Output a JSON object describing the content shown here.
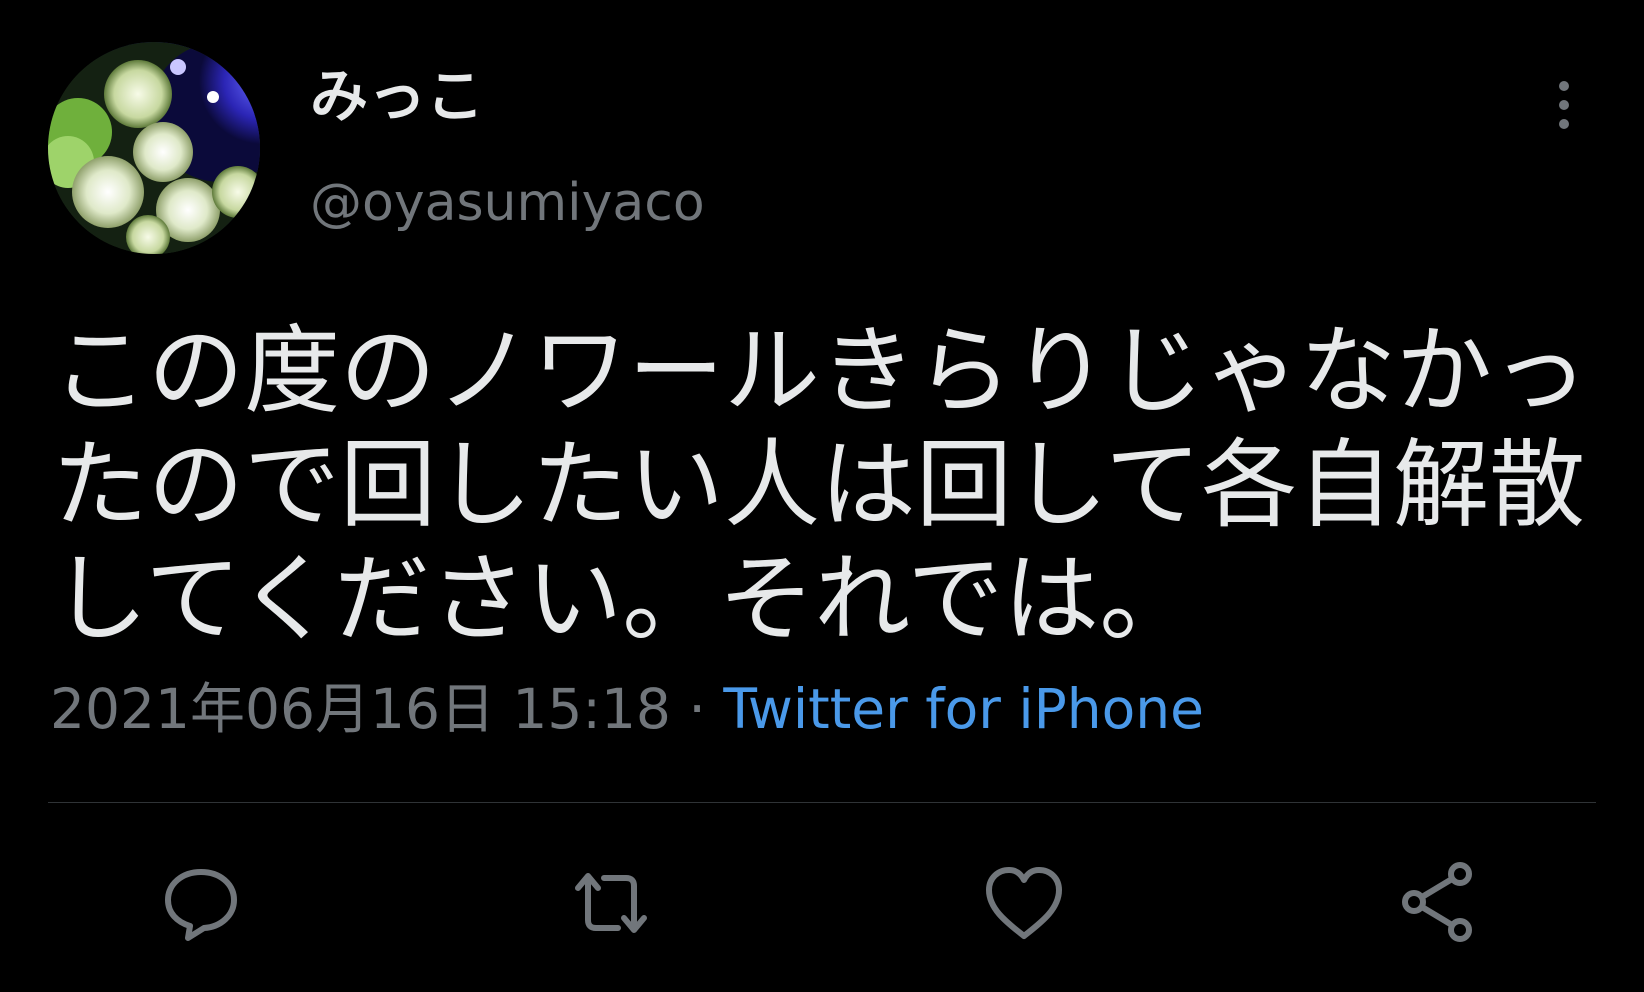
{
  "user": {
    "display_name": "みっこ",
    "handle": "@oyasumiyaco"
  },
  "tweet": {
    "text": "この度のノワールきらりじゃなかったので回したい人は回して各自解散してください。それでは。",
    "timestamp": "2021年06月16日 15:18",
    "separator": " · ",
    "source": "Twitter for iPhone"
  },
  "icons": {
    "more": "more-vertical-icon",
    "reply": "reply-icon",
    "retweet": "retweet-icon",
    "like": "heart-icon",
    "share": "share-icon"
  },
  "colors": {
    "background": "#000000",
    "text": "#e7e9ea",
    "secondary": "#71767b",
    "link": "#4a99e9",
    "divider": "#2f3336"
  }
}
